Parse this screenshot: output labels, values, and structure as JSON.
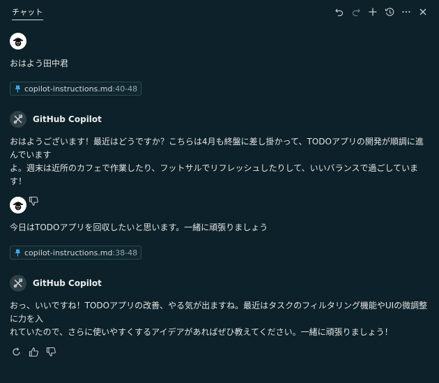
{
  "header": {
    "tab_label": "チャット",
    "toolbar": [
      {
        "name": "undo-icon",
        "label": "undo"
      },
      {
        "name": "redo-icon",
        "label": "redo"
      },
      {
        "name": "new-chat-icon",
        "label": "new"
      },
      {
        "name": "history-icon",
        "label": "history"
      },
      {
        "name": "more-icon",
        "label": "more"
      },
      {
        "name": "close-icon",
        "label": "close"
      }
    ]
  },
  "messages": [
    {
      "role": "user",
      "text": "おはよう田中君",
      "reference": {
        "file": "copilot-instructions.md",
        "range": ":40-48"
      }
    },
    {
      "role": "assistant",
      "sender": "GitHub Copilot",
      "text": "おはようございます！最近はどうですか？こちらは4月も終盤に差し掛かって、TODOアプリの開発が順調に進んでいます\nよ。週末は近所のカフェで作業したり、フットサルでリフレッシュしたりして、いいバランスで過ごしています！"
    },
    {
      "role": "user",
      "text": "今日はTODOアプリを回収したいと思います。一緒に頑張りましょう",
      "reference": {
        "file": "copilot-instructions.md",
        "range": ":38-48"
      }
    },
    {
      "role": "assistant",
      "sender": "GitHub Copilot",
      "text": "おっ、いいですね！TODOアプリの改善、やる気が出ますね。最近はタスクのフィルタリング機能やUIの微調整に力を入\nれていたので、さらに使いやすくするアイデアがあればぜひ教えてください。一緒に頑張りましょう！"
    }
  ],
  "colors": {
    "background": "#0c2129",
    "text": "#e3e3e3",
    "pin": "#3ea8e8"
  }
}
